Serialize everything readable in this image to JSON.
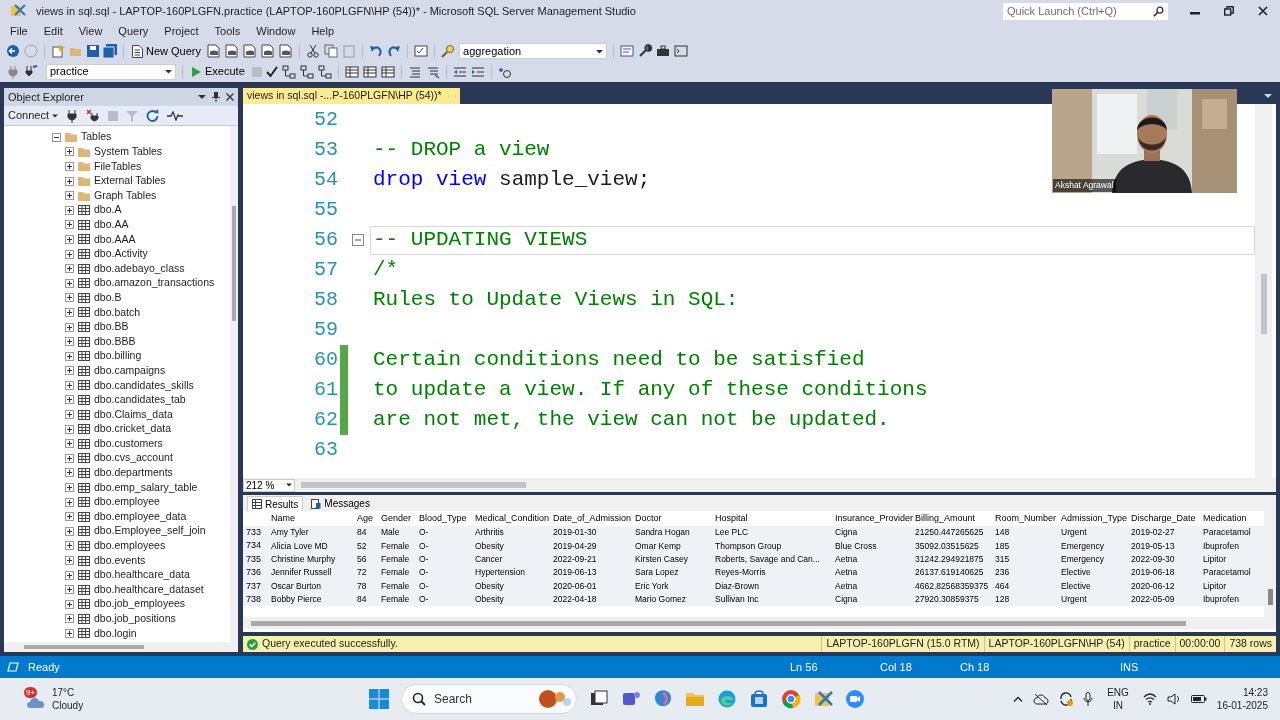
{
  "window": {
    "title": "views in sql.sql - LAPTOP-160PLGFN.practice (LAPTOP-160PLGFN\\HP (54))* - Microsoft SQL Server Management Studio"
  },
  "quick_launch": {
    "placeholder": "Quick Launch (Ctrl+Q)"
  },
  "menu": [
    "File",
    "Edit",
    "View",
    "Query",
    "Project",
    "Tools",
    "Window",
    "Help"
  ],
  "toolbar": {
    "new_query": "New Query",
    "search_box": "aggregation",
    "database": "practice",
    "execute": "Execute"
  },
  "object_explorer": {
    "title": "Object Explorer",
    "connect": "Connect",
    "tree": {
      "label": "Tables",
      "kind": "folder",
      "expanded": true,
      "children": [
        {
          "label": "System Tables",
          "kind": "folder",
          "expanded": false
        },
        {
          "label": "FileTables",
          "kind": "folder",
          "expanded": false
        },
        {
          "label": "External Tables",
          "kind": "folder",
          "expanded": false
        },
        {
          "label": "Graph Tables",
          "kind": "folder",
          "expanded": false
        },
        {
          "label": "dbo.A",
          "kind": "table",
          "expanded": false
        },
        {
          "label": "dbo.AA",
          "kind": "table",
          "expanded": false
        },
        {
          "label": "dbo.AAA",
          "kind": "table",
          "expanded": false
        },
        {
          "label": "dbo.Activity",
          "kind": "table",
          "expanded": false
        },
        {
          "label": "dbo.adebayo_class",
          "kind": "table",
          "expanded": false
        },
        {
          "label": "dbo.amazon_transactions",
          "kind": "table",
          "expanded": false
        },
        {
          "label": "dbo.B",
          "kind": "table",
          "expanded": false
        },
        {
          "label": "dbo.batch",
          "kind": "table",
          "expanded": false
        },
        {
          "label": "dbo.BB",
          "kind": "table",
          "expanded": false
        },
        {
          "label": "dbo.BBB",
          "kind": "table",
          "expanded": false
        },
        {
          "label": "dbo.billing",
          "kind": "table",
          "expanded": false
        },
        {
          "label": "dbo.campaigns",
          "kind": "table",
          "expanded": false
        },
        {
          "label": "dbo.candidates_skills",
          "kind": "table",
          "expanded": false
        },
        {
          "label": "dbo.candidates_tab",
          "kind": "table",
          "expanded": false
        },
        {
          "label": "dbo.Claims_data",
          "kind": "table",
          "expanded": false
        },
        {
          "label": "dbo.cricket_data",
          "kind": "table",
          "expanded": false
        },
        {
          "label": "dbo.customers",
          "kind": "table",
          "expanded": false
        },
        {
          "label": "dbo.cvs_account",
          "kind": "table",
          "expanded": false
        },
        {
          "label": "dbo.departments",
          "kind": "table",
          "expanded": false
        },
        {
          "label": "dbo.emp_salary_table",
          "kind": "table",
          "expanded": false
        },
        {
          "label": "dbo.employee",
          "kind": "table",
          "expanded": false
        },
        {
          "label": "dbo.employee_data",
          "kind": "table",
          "expanded": false
        },
        {
          "label": "dbo.Employee_self_join",
          "kind": "table",
          "expanded": false
        },
        {
          "label": "dbo.employees",
          "kind": "table",
          "expanded": false
        },
        {
          "label": "dbo.events",
          "kind": "table",
          "expanded": false
        },
        {
          "label": "dbo.healthcare_data",
          "kind": "table",
          "expanded": false
        },
        {
          "label": "dbo.healthcare_dataset",
          "kind": "table",
          "expanded": false
        },
        {
          "label": "dbo.job_employees",
          "kind": "table",
          "expanded": false
        },
        {
          "label": "dbo.job_positions",
          "kind": "table",
          "expanded": false
        },
        {
          "label": "dbo.login",
          "kind": "table",
          "expanded": false
        }
      ]
    }
  },
  "editor_tab": {
    "title": "views in sql.sql -...P-160PLGFN\\HP (54))*"
  },
  "code_lines": [
    {
      "number": "52",
      "changed": false,
      "current": false,
      "foldable": false
    },
    {
      "number": "53",
      "changed": false,
      "current": false,
      "foldable": false,
      "segments": [
        {
          "kind": "comment",
          "text": "-- DROP a view"
        }
      ]
    },
    {
      "number": "54",
      "changed": false,
      "current": false,
      "foldable": false,
      "segments": [
        {
          "kind": "keyword",
          "text": "drop view"
        },
        {
          "kind": "plain",
          "text": " sample_view;"
        }
      ]
    },
    {
      "number": "55",
      "changed": false,
      "current": false,
      "foldable": false
    },
    {
      "number": "56",
      "changed": false,
      "current": true,
      "foldable": true,
      "segments": [
        {
          "kind": "comment",
          "text": "-- UPDATING VIEWS"
        }
      ]
    },
    {
      "number": "57",
      "changed": false,
      "current": false,
      "foldable": false,
      "segments": [
        {
          "kind": "comment",
          "text": "/*"
        }
      ]
    },
    {
      "number": "58",
      "changed": false,
      "current": false,
      "foldable": false,
      "segments": [
        {
          "kind": "comment",
          "text": "Rules to Update Views in SQL:"
        }
      ]
    },
    {
      "number": "59",
      "changed": false,
      "current": false,
      "foldable": false
    },
    {
      "number": "60",
      "changed": true,
      "current": false,
      "foldable": false,
      "segments": [
        {
          "kind": "comment",
          "text": "Certain conditions need to be satisfied"
        }
      ]
    },
    {
      "number": "61",
      "changed": true,
      "current": false,
      "foldable": false,
      "segments": [
        {
          "kind": "comment",
          "text": "to update a view. If any of these conditions"
        }
      ]
    },
    {
      "number": "62",
      "changed": true,
      "current": false,
      "foldable": false,
      "segments": [
        {
          "kind": "comment",
          "text": "are not met, the view can not be updated."
        }
      ]
    },
    {
      "number": "63",
      "changed": false,
      "current": false,
      "foldable": false
    }
  ],
  "zoom": "212 %",
  "webcam": {
    "kind": "picture",
    "name": "Akshat Agrawal"
  },
  "results": {
    "tabs": [
      {
        "label": "Results",
        "selected": true
      },
      {
        "label": "Messages",
        "selected": false
      }
    ],
    "columns": [
      "Name",
      "Age",
      "Gender",
      "Blood_Type",
      "Medical_Condition",
      "Date_of_Admission",
      "Doctor",
      "Hospital",
      "Insurance_Provider",
      "Billing_Amount",
      "Room_Number",
      "Admission_Type",
      "Discharge_Date",
      "Medication"
    ],
    "rows": [
      {
        "number": "733",
        "cells": [
          "Amy Tyler",
          "84",
          "Male",
          "O-",
          "Arthritis",
          "2019-01-30",
          "Sandra Hogan",
          "Lee PLC",
          "Cigna",
          "21250.447265625",
          "148",
          "Urgent",
          "2019-02-27",
          "Paracetamol"
        ]
      },
      {
        "number": "734",
        "cells": [
          "Alicia Love MD",
          "52",
          "Female",
          "O-",
          "Obesity",
          "2019-04-29",
          "Omar Kemp",
          "Thompson Group",
          "Blue Cross",
          "35092.03515625",
          "185",
          "Emergency",
          "2019-05-13",
          "Ibuprofen"
        ]
      },
      {
        "number": "735",
        "cells": [
          "Christine Murphy",
          "56",
          "Female",
          "O-",
          "Cancer",
          "2022-09-21",
          "Kirsten Casey",
          "Roberts, Savage and Can...",
          "Aetna",
          "31242.294921875",
          "315",
          "Emergency",
          "2022-09-30",
          "Lipitor"
        ]
      },
      {
        "number": "736",
        "cells": [
          "Jennifer Russell",
          "72",
          "Female",
          "O-",
          "Hypertension",
          "2019-06-13",
          "Sara Lopez",
          "Reyes-Morris",
          "Aetna",
          "26137.619140625",
          "236",
          "Elective",
          "2019-06-18",
          "Paracetamol"
        ]
      },
      {
        "number": "737",
        "cells": [
          "Oscar Burton",
          "78",
          "Female",
          "O-",
          "Obesity",
          "2020-06-01",
          "Eric York",
          "Diaz-Brown",
          "Aetna",
          "4662.82568359375",
          "464",
          "Elective",
          "2020-06-12",
          "Lipitor"
        ]
      },
      {
        "number": "738",
        "cells": [
          "Bobby Pierce",
          "84",
          "Female",
          "O-",
          "Obesity",
          "2022-04-18",
          "Mario Gomez",
          "Sullivan Inc",
          "Cigna",
          "27920.30859375",
          "128",
          "Urgent",
          "2022-05-09",
          "Ibuprofen"
        ]
      }
    ]
  },
  "query_status": {
    "message": "Query executed successfully.",
    "server": "LAPTOP-160PLGFN (15.0 RTM)",
    "login": "LAPTOP-160PLGFN\\HP (54)",
    "database": "practice",
    "elapsed": "00:00:00",
    "rows": "738 rows"
  },
  "status_bar": {
    "state": "Ready",
    "line": "Ln 56",
    "column": "Col 18",
    "char": "Ch 18",
    "mode": "INS"
  },
  "taskbar": {
    "weather": {
      "badge": "9+",
      "temperature": "17°C",
      "condition": "Cloudy"
    },
    "search": "Search",
    "language": [
      "ENG",
      "IN"
    ],
    "time": "14:23",
    "date": "16-01-2025"
  }
}
